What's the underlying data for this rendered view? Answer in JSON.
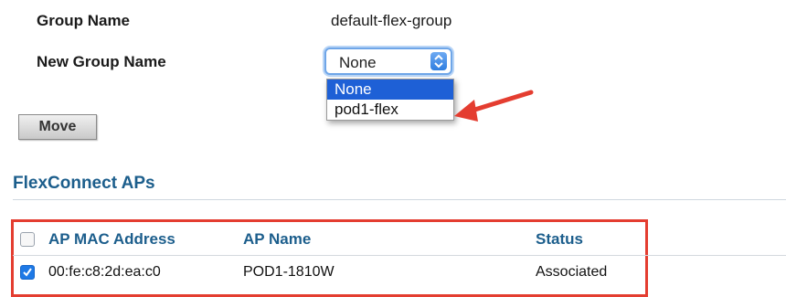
{
  "form": {
    "group_name_label": "Group Name",
    "group_name_value": "default-flex-group",
    "new_group_name_label": "New Group Name",
    "new_group_name_selected": "None",
    "dropdown_options": [
      "None",
      "pod1-flex"
    ],
    "move_button": "Move"
  },
  "section": {
    "title": "FlexConnect APs"
  },
  "table": {
    "headers": [
      "AP MAC Address",
      "AP Name",
      "Status"
    ],
    "rows": [
      {
        "checked": true,
        "mac": "00:fe:c8:2d:ea:c0",
        "name": "POD1-1810W",
        "status": "Associated"
      }
    ]
  },
  "colors": {
    "accent": "#1c5e8c",
    "highlight": "#e43d30",
    "selection": "#1e60d6"
  },
  "icons": {
    "dropdown": "chevron-updown-icon",
    "annotation": "arrow-left-icon"
  }
}
